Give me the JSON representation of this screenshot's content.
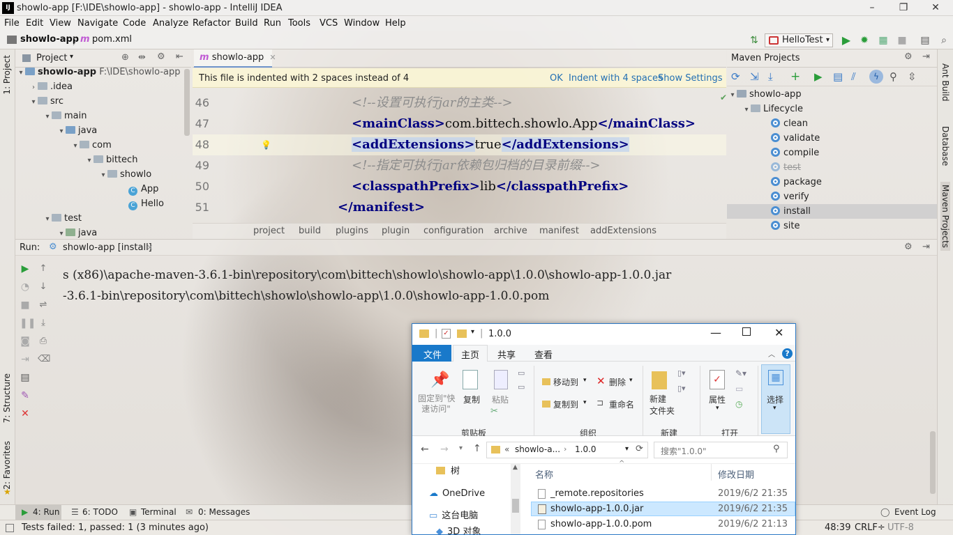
{
  "window": {
    "title": "showlo-app [F:\\IDE\\showlo-app] - showlo-app - IntelliJ IDEA",
    "logo_text": "IJ"
  },
  "menu": [
    "File",
    "Edit",
    "View",
    "Navigate",
    "Code",
    "Analyze",
    "Refactor",
    "Build",
    "Run",
    "Tools",
    "VCS",
    "Window",
    "Help"
  ],
  "navbar": {
    "project": "showlo-app",
    "file": "pom.xml",
    "run_config": "HelloTest"
  },
  "left_strip": {
    "project_tab": "1: Project",
    "structure_tab": "7: Structure",
    "favorites_tab": "2: Favorites"
  },
  "right_strip": {
    "ant": "Ant Build",
    "database": "Database",
    "maven": "Maven Projects"
  },
  "project_panel": {
    "title": "Project",
    "root_name": "showlo-app",
    "root_path": "F:\\IDE\\showlo-app",
    "items": [
      ".idea",
      "src",
      "main",
      "java",
      "com",
      "bittech",
      "showlo",
      "App",
      "Hello",
      "test",
      "java"
    ]
  },
  "editor": {
    "tab": "showlo-app",
    "banner": "This file is indented with 2 spaces instead of 4",
    "banner_actions": [
      "OK",
      "Indent with 4 spaces",
      "Show Settings"
    ],
    "line_numbers": [
      "46",
      "47",
      "48",
      "49",
      "50",
      "51"
    ],
    "lines": {
      "l46": "<!--设置可执行jar的主类-->",
      "l47_open": "<mainClass>",
      "l47_text": "com.bittech.showlo.App",
      "l47_close": "</mainClass>",
      "l48_open": "<addExtensions>",
      "l48_text": "true",
      "l48_close": "</addExtensions>",
      "l49": "<!--指定可执行jar依赖包归档的目录前缀-->",
      "l50_open": "<classpathPrefix>",
      "l50_text": "lib",
      "l50_close": "</classpathPrefix>",
      "l51": "</manifest>"
    },
    "breadcrumbs": [
      "project",
      "build",
      "plugins",
      "plugin",
      "configuration",
      "archive",
      "manifest",
      "addExtensions"
    ]
  },
  "maven": {
    "title": "Maven Projects",
    "project": "showlo-app",
    "lifecycle_label": "Lifecycle",
    "phases": [
      "clean",
      "validate",
      "compile",
      "test",
      "package",
      "verify",
      "install",
      "site"
    ]
  },
  "run": {
    "label": "Run:",
    "tab": "showlo-app [install]",
    "console": [
      "s (x86)\\apache-maven-3.6.1-bin\\repository\\com\\bittech\\showlo\\showlo-app\\1.0.0\\showlo-app-1.0.0.jar",
      "-3.6.1-bin\\repository\\com\\bittech\\showlo\\showlo-app\\1.0.0\\showlo-app-1.0.0.pom"
    ]
  },
  "bottom_tabs": {
    "run": "4: Run",
    "todo": "6: TODO",
    "terminal": "Terminal",
    "messages": "0: Messages",
    "event_log": "Event Log"
  },
  "status": {
    "message": "Tests failed: 1, passed: 1 (3 minutes ago)",
    "position": "48:39",
    "line_sep": "CRLF÷",
    "encoding": "UTF-8"
  },
  "explorer": {
    "title": "1.0.0",
    "tabs": [
      "文件",
      "主页",
      "共享",
      "查看"
    ],
    "ribbon": {
      "pin": "固定到\"快\n速访问\"",
      "copy": "复制",
      "paste": "粘贴",
      "group_clipboard": "剪贴板",
      "move_to": "移动到",
      "copy_to": "复制到",
      "delete": "删除",
      "rename": "重命名",
      "group_organize": "组织",
      "new_folder": "新建\n文件夹",
      "group_new": "新建",
      "properties": "属性",
      "group_open": "打开",
      "select": "选择"
    },
    "address": {
      "parent": "showlo-a...",
      "current": "1.0.0"
    },
    "search_placeholder": "搜索\"1.0.0\"",
    "nav_items": [
      "树",
      "OneDrive",
      "这台电脑",
      "3D 对象"
    ],
    "columns": [
      "名称",
      "修改日期"
    ],
    "files": [
      {
        "name": "_remote.repositories",
        "date": "2019/6/2 21:35"
      },
      {
        "name": "showlo-app-1.0.0.jar",
        "date": "2019/6/2 21:35"
      },
      {
        "name": "showlo-app-1.0.0.pom",
        "date": "2019/6/2 21:13"
      }
    ]
  }
}
